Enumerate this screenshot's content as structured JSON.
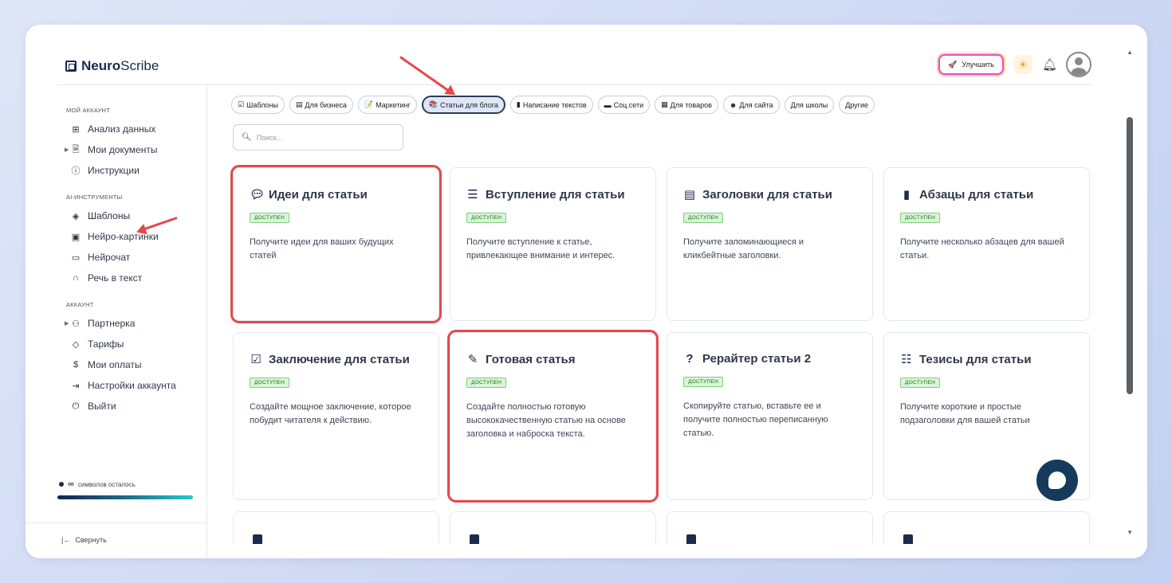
{
  "header": {
    "logo_bold": "Neuro",
    "logo_rest": "Scribe",
    "upgrade_label": "Улучшить"
  },
  "sidebar": {
    "sections": [
      {
        "title": "МОЙ АККАУНТ",
        "items": [
          {
            "label": "Анализ данных",
            "icon": "grid-icon"
          },
          {
            "label": "Мои документы",
            "icon": "document-icon"
          },
          {
            "label": "Инструкции",
            "icon": "help-icon"
          }
        ]
      },
      {
        "title": "AI-ИНСТРУМЕНТЫ",
        "items": [
          {
            "label": "Шаблоны",
            "icon": "layers-icon"
          },
          {
            "label": "Нейро-картинки",
            "icon": "image-icon"
          },
          {
            "label": "Нейрочат",
            "icon": "chat-icon"
          },
          {
            "label": "Речь в текст",
            "icon": "headphones-icon"
          }
        ]
      },
      {
        "title": "АККАУНТ",
        "items": [
          {
            "label": "Партнерка",
            "icon": "users-icon"
          },
          {
            "label": "Тарифы",
            "icon": "tag-icon"
          },
          {
            "label": "Мои оплаты",
            "icon": "dollar-icon"
          },
          {
            "label": "Настройки аккаунта",
            "icon": "login-icon"
          },
          {
            "label": "Выйти",
            "icon": "power-icon"
          }
        ]
      }
    ],
    "usage_symbol": "∞",
    "usage_text": "символов осталось",
    "collapse_label": "Свернуть"
  },
  "filters": [
    {
      "label": "Шаблоны",
      "icon": "☑"
    },
    {
      "label": "Для бизнеса",
      "icon": "▤"
    },
    {
      "label": "Маркетинг",
      "icon": "📝"
    },
    {
      "label": "Статьи для блога",
      "icon": "📚",
      "active": true
    },
    {
      "label": "Написание текстов",
      "icon": "▮"
    },
    {
      "label": "Соц.сети",
      "icon": "▬"
    },
    {
      "label": "Для товаров",
      "icon": "▦"
    },
    {
      "label": "Для сайта",
      "icon": "☻"
    },
    {
      "label": "Для школы",
      "icon": ""
    },
    {
      "label": "Другие",
      "icon": ""
    }
  ],
  "search": {
    "placeholder": "Поиск..."
  },
  "badge_label": "ДОСТУПЕН",
  "cards": [
    {
      "title": "Идеи для статьи",
      "icon": "speech-bubble-icon",
      "desc": "Получите идеи для ваших будущих статей"
    },
    {
      "title": "Вступление для статьи",
      "icon": "lines-icon",
      "desc": "Получите вступление к статье, привлекающее внимание и интерес."
    },
    {
      "title": "Заголовки для статьи",
      "icon": "notepad-icon",
      "desc": "Получите запоминающиеся и кликбейтные заголовки."
    },
    {
      "title": "Абзацы для статьи",
      "icon": "book-icon",
      "desc": "Получите несколько абзацев для вашей статьи."
    },
    {
      "title": "Заключение для статьи",
      "icon": "checkbox-icon",
      "desc": "Создайте мощное заключение, которое побудит читателя к действию."
    },
    {
      "title": "Готовая статья",
      "icon": "pen-icon",
      "desc": "Создайте полностью готовую высококачественную статью на основе заголовка и наброска текста."
    },
    {
      "title": "Рерайтер статьи 2",
      "icon": "question-icon",
      "desc": "Скопируйте статью, вставьте ее и получите полностью переписанную статью."
    },
    {
      "title": "Тезисы для статьи",
      "icon": "list-icon",
      "desc": "Получите короткие и простые подзаголовки для вашей статьи"
    }
  ]
}
